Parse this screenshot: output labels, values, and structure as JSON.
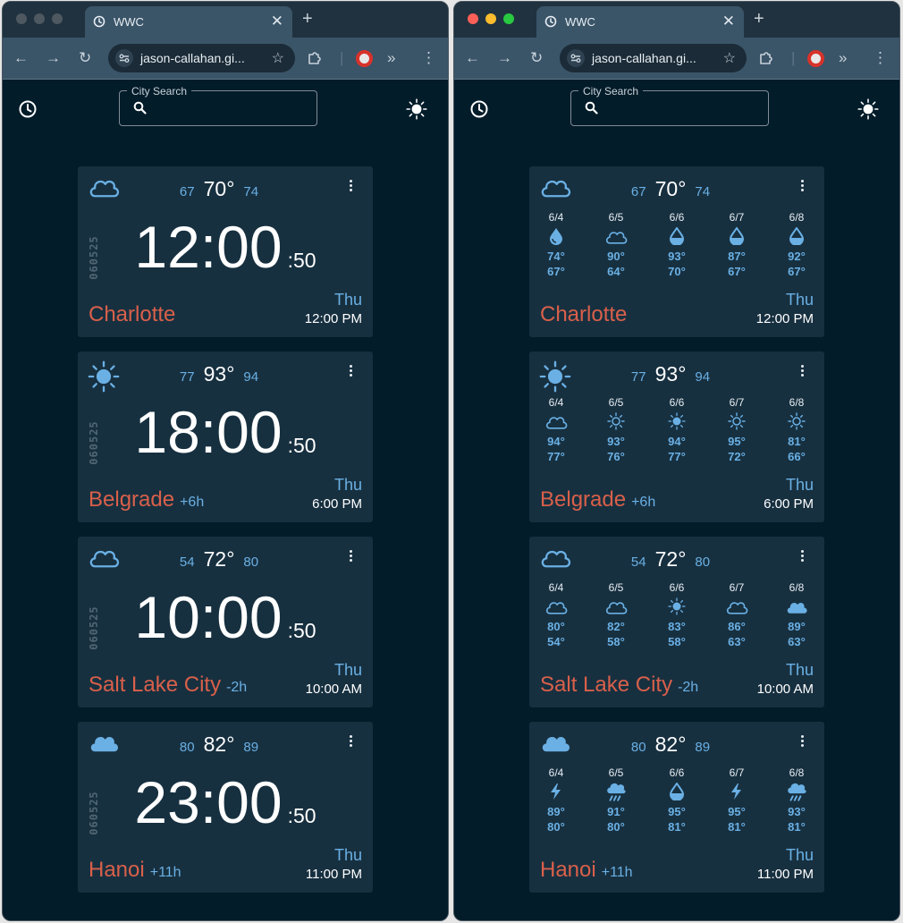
{
  "browser": {
    "tab_title": "WWC",
    "url": "jason-callahan.gi...",
    "new_tab": "+",
    "close_tab": "✕"
  },
  "app": {
    "search_label": "City Search",
    "search_placeholder": ""
  },
  "cities": [
    {
      "name": "Charlotte",
      "offset": "",
      "weather_icon": "cloud-outline-icon",
      "low": "67",
      "current": "70°",
      "high": "74",
      "date_code": "060525",
      "time_main": "12:00",
      "time_seconds": ":50",
      "day": "Thu",
      "clock": "12:00 PM",
      "forecast": [
        {
          "date": "6/4",
          "icon": "drop-icon",
          "hi": "74°",
          "lo": "67°"
        },
        {
          "date": "6/5",
          "icon": "cloud-outline-icon",
          "hi": "90°",
          "lo": "64°"
        },
        {
          "date": "6/6",
          "icon": "drop-half-icon",
          "hi": "93°",
          "lo": "70°"
        },
        {
          "date": "6/7",
          "icon": "drop-half-icon",
          "hi": "87°",
          "lo": "67°"
        },
        {
          "date": "6/8",
          "icon": "drop-half-icon",
          "hi": "92°",
          "lo": "67°"
        }
      ]
    },
    {
      "name": "Belgrade",
      "offset": "+6h",
      "weather_icon": "sun-icon",
      "low": "77",
      "current": "93°",
      "high": "94",
      "date_code": "060525",
      "time_main": "18:00",
      "time_seconds": ":50",
      "day": "Thu",
      "clock": "6:00 PM",
      "forecast": [
        {
          "date": "6/4",
          "icon": "cloud-outline-icon",
          "hi": "94°",
          "lo": "77°"
        },
        {
          "date": "6/5",
          "icon": "sun-outline-icon",
          "hi": "93°",
          "lo": "76°"
        },
        {
          "date": "6/6",
          "icon": "sun-icon",
          "hi": "94°",
          "lo": "77°"
        },
        {
          "date": "6/7",
          "icon": "sun-outline-icon",
          "hi": "95°",
          "lo": "72°"
        },
        {
          "date": "6/8",
          "icon": "sun-outline-icon",
          "hi": "81°",
          "lo": "66°"
        }
      ]
    },
    {
      "name": "Salt Lake City",
      "offset": "-2h",
      "weather_icon": "cloud-outline-icon",
      "low": "54",
      "current": "72°",
      "high": "80",
      "date_code": "060525",
      "time_main": "10:00",
      "time_seconds": ":50",
      "day": "Thu",
      "clock": "10:00 AM",
      "forecast": [
        {
          "date": "6/4",
          "icon": "cloud-outline-icon",
          "hi": "80°",
          "lo": "54°"
        },
        {
          "date": "6/5",
          "icon": "cloud-outline-icon",
          "hi": "82°",
          "lo": "58°"
        },
        {
          "date": "6/6",
          "icon": "sun-icon",
          "hi": "83°",
          "lo": "58°"
        },
        {
          "date": "6/7",
          "icon": "cloud-outline-icon",
          "hi": "86°",
          "lo": "63°"
        },
        {
          "date": "6/8",
          "icon": "cloud-filled-icon",
          "hi": "89°",
          "lo": "63°"
        }
      ]
    },
    {
      "name": "Hanoi",
      "offset": "+11h",
      "weather_icon": "cloud-filled-icon",
      "low": "80",
      "current": "82°",
      "high": "89",
      "date_code": "060525",
      "time_main": "23:00",
      "time_seconds": ":50",
      "day": "Thu",
      "clock": "11:00 PM",
      "forecast": [
        {
          "date": "6/4",
          "icon": "lightning-icon",
          "hi": "89°",
          "lo": "80°"
        },
        {
          "date": "6/5",
          "icon": "storm-cloud-icon",
          "hi": "91°",
          "lo": "80°"
        },
        {
          "date": "6/6",
          "icon": "drop-half-icon",
          "hi": "95°",
          "lo": "81°"
        },
        {
          "date": "6/7",
          "icon": "lightning-icon",
          "hi": "95°",
          "lo": "81°"
        },
        {
          "date": "6/8",
          "icon": "storm-cloud-icon",
          "hi": "93°",
          "lo": "81°"
        }
      ]
    }
  ],
  "colors": {
    "background": "#031c29",
    "card": "#173040",
    "accent_blue": "#6ab0e4",
    "city_red": "#d9604a",
    "chrome_tab": "#3a5468"
  }
}
